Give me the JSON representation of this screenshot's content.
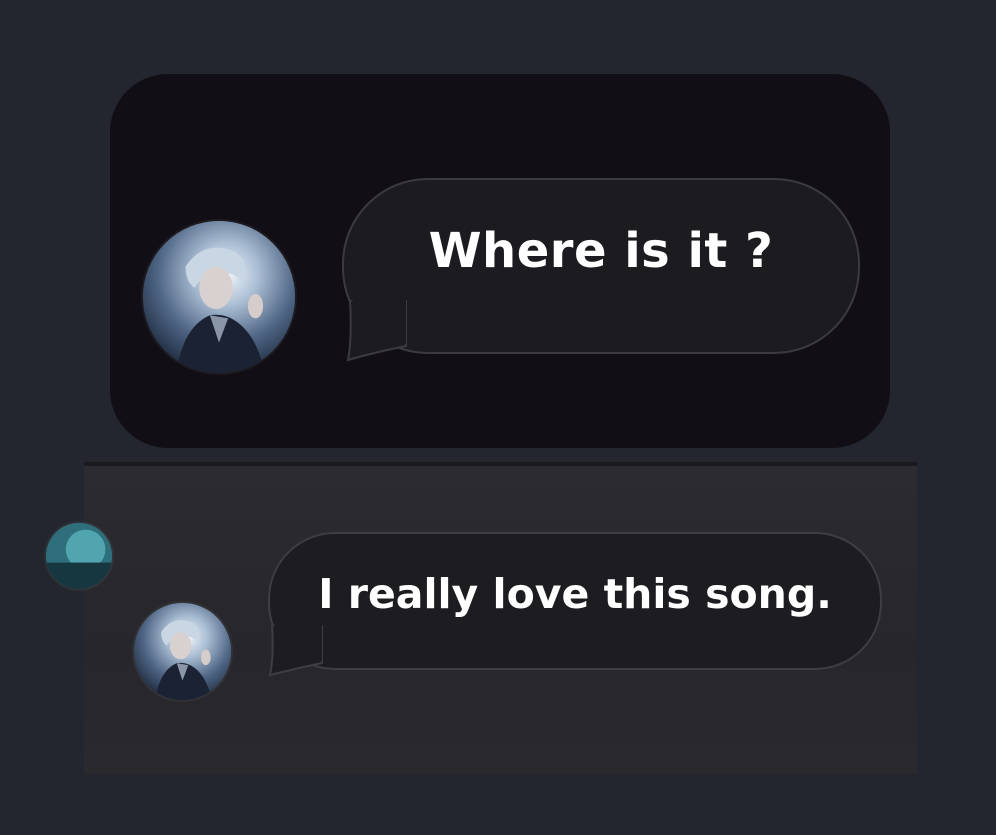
{
  "messages": [
    {
      "text": "Where is it ?",
      "avatar": "profile-photo"
    },
    {
      "text": "I really love this song.",
      "avatar": "profile-photo"
    }
  ],
  "colors": {
    "background": "#23262e",
    "top_card": "#110f15",
    "bottom_panel": "#2b2b2f",
    "bubble": "#1c1c20",
    "bubble_border": "#3a3a40",
    "text": "#ffffff"
  }
}
